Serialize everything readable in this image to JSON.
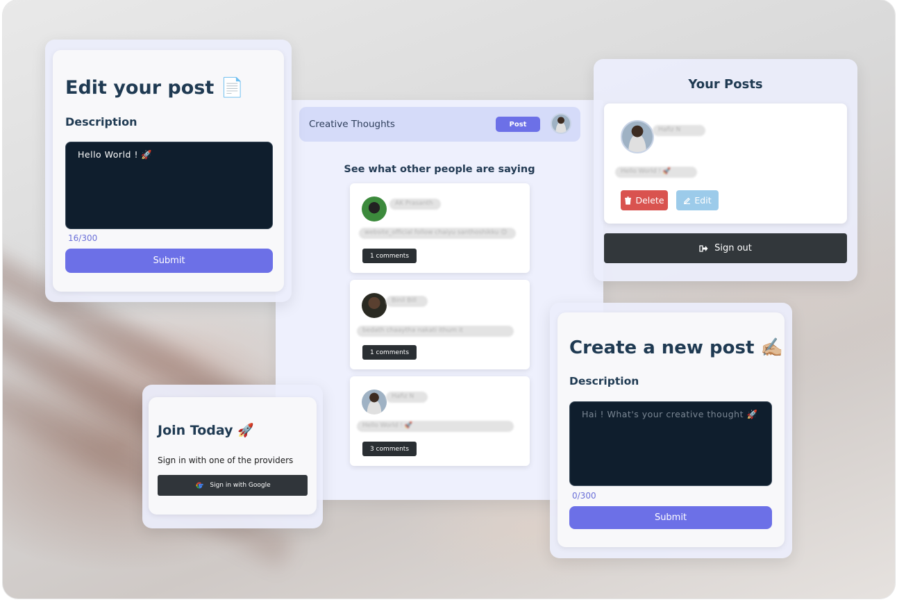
{
  "edit_post": {
    "title": "Edit your post 📄",
    "description_label": "Description",
    "textarea_value": "Hello World ! 🚀",
    "char_count": "16/300",
    "submit_label": "Submit"
  },
  "feed": {
    "brand": "Creative Thoughts",
    "post_button": "Post",
    "heading": "See what other people are saying",
    "posts": [
      {
        "author": "AK Prasanth",
        "text": "website_official follow chaiyu santhoshikku 😊",
        "comments": "1 comments"
      },
      {
        "author": "Binil Bill",
        "text": "bedath chaaytha nakati ithum it",
        "comments": "1 comments"
      },
      {
        "author": "Hafiz N",
        "text": "Hello World ! 🚀",
        "comments": "3 comments"
      }
    ]
  },
  "your_posts": {
    "title": "Your Posts",
    "author": "Hafiz N",
    "text": "Hello World ! 🚀",
    "delete_label": "Delete",
    "edit_label": "Edit",
    "signout_label": "Sign out"
  },
  "join": {
    "title": "Join Today 🚀",
    "subtitle": "Sign in with one of the providers",
    "google_label": "Sign in with Google"
  },
  "create_post": {
    "title": "Create a new post ✍🏼",
    "description_label": "Description",
    "placeholder": "Hai ! What's your creative thought 🚀",
    "char_count": "0/300",
    "submit_label": "Submit"
  },
  "colors": {
    "accent": "#6c70e7",
    "dark_button": "#30353a",
    "delete": "#d9534f",
    "edit": "#9ccbea",
    "textarea_bg": "#0f1e2d"
  }
}
